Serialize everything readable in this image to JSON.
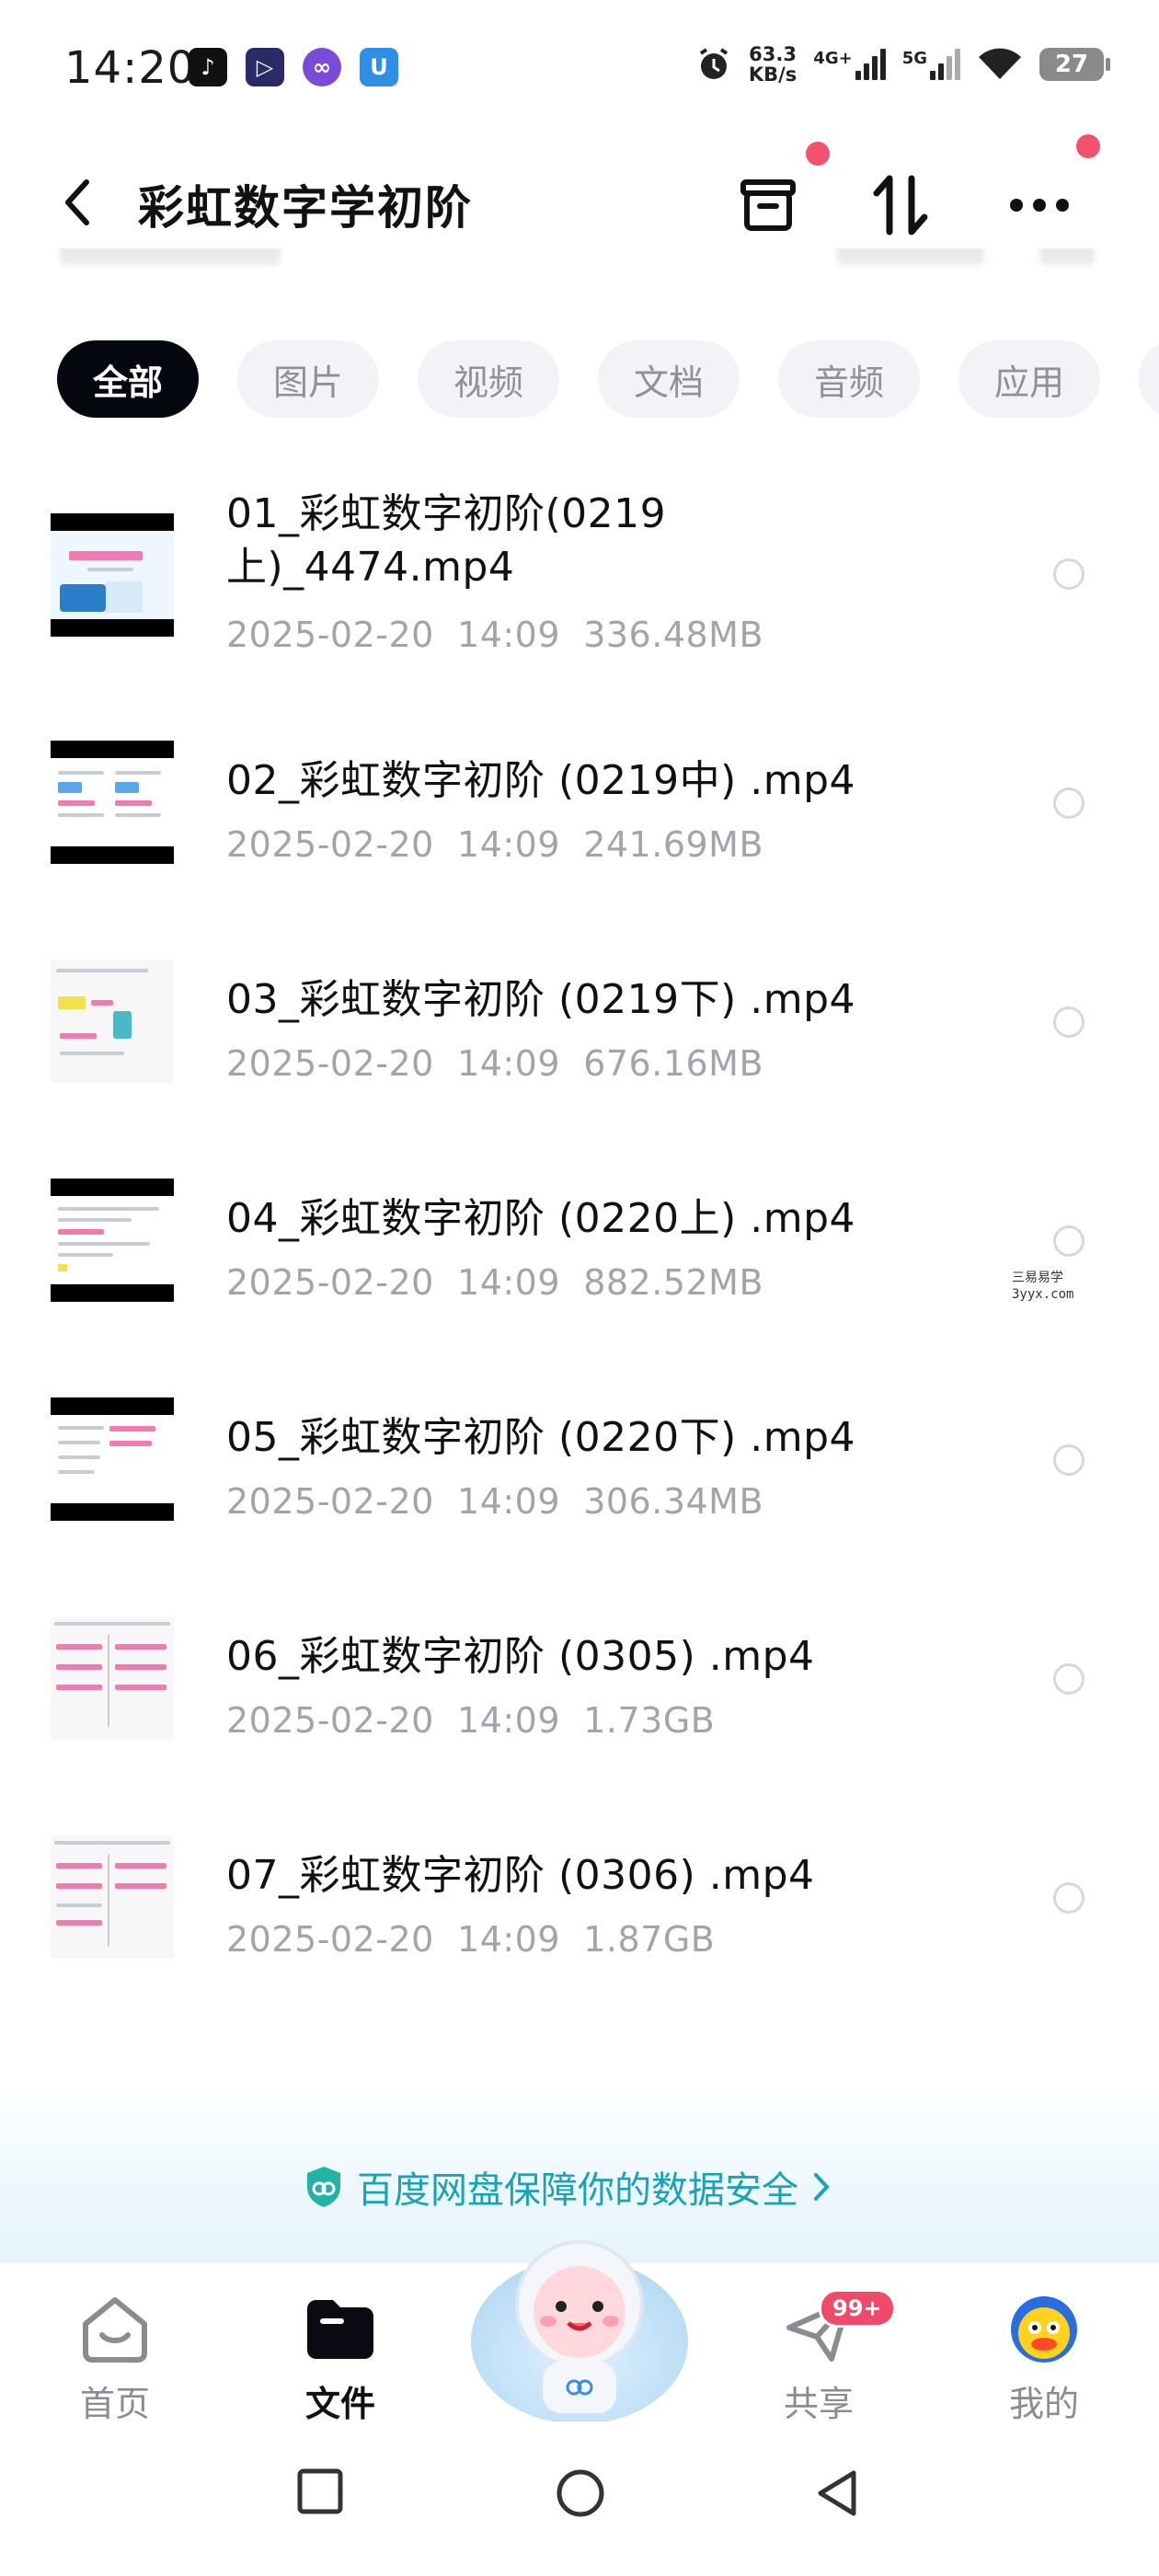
{
  "status_bar": {
    "time": "14:20",
    "net_speed_value": "63.3",
    "net_speed_unit": "KB/s",
    "signal1": "4G+",
    "signal2": "5G",
    "battery": "27",
    "app_icons": [
      "tiktok-icon",
      "player-icon",
      "infinity-icon",
      "shield-app-icon"
    ]
  },
  "header": {
    "title": "彩虹数字学初阶"
  },
  "tabs": [
    "全部",
    "图片",
    "视频",
    "文档",
    "音频",
    "应用"
  ],
  "files": [
    {
      "name": "01_彩虹数字初阶(0219\n上)_4474.mp4",
      "date": "2025-02-20",
      "time": "14:09",
      "size": "336.48MB"
    },
    {
      "name": "02_彩虹数字初阶 (0219中) .mp4",
      "date": "2025-02-20",
      "time": "14:09",
      "size": "241.69MB"
    },
    {
      "name": "03_彩虹数字初阶 (0219下) .mp4",
      "date": "2025-02-20",
      "time": "14:09",
      "size": "676.16MB"
    },
    {
      "name": "04_彩虹数字初阶 (0220上) .mp4",
      "date": "2025-02-20",
      "time": "14:09",
      "size": "882.52MB"
    },
    {
      "name": "05_彩虹数字初阶 (0220下) .mp4",
      "date": "2025-02-20",
      "time": "14:09",
      "size": "306.34MB"
    },
    {
      "name": "06_彩虹数字初阶 (0305) .mp4",
      "date": "2025-02-20",
      "time": "14:09",
      "size": "1.73GB"
    },
    {
      "name": "07_彩虹数字初阶 (0306) .mp4",
      "date": "2025-02-20",
      "time": "14:09",
      "size": "1.87GB"
    }
  ],
  "watermark": {
    "line1": "三易易学",
    "line2": "3yyx.com"
  },
  "security_banner": "百度网盘保障你的数据安全",
  "bottom_nav": {
    "home": "首页",
    "files": "文件",
    "share": "共享",
    "share_badge": "99+",
    "me": "我的"
  },
  "colors": {
    "accent": "#1aa2b8",
    "badge": "#f14a68",
    "active_tab": "#05070f"
  }
}
